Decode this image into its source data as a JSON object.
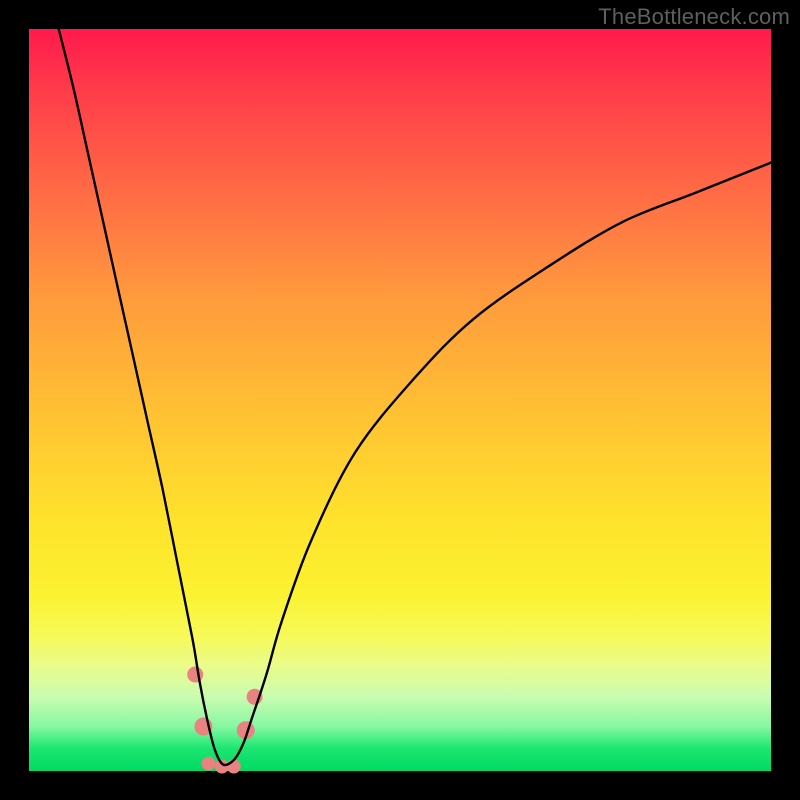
{
  "watermark": "TheBottleneck.com",
  "chart_data": {
    "type": "line",
    "title": "",
    "xlabel": "",
    "ylabel": "",
    "xlim": [
      0,
      100
    ],
    "ylim": [
      0,
      100
    ],
    "background_gradient": {
      "top_color": "#ff1a4d",
      "bottom_color": "#00d964",
      "meaning": "bottleneck severity (red=high, green=low)"
    },
    "series": [
      {
        "name": "bottleneck-curve",
        "color": "#000000",
        "x": [
          4,
          6,
          8,
          10,
          12,
          14,
          16,
          18,
          20,
          22,
          23,
          24,
          25,
          26,
          27,
          28,
          29,
          30,
          32,
          34,
          38,
          44,
          52,
          60,
          70,
          80,
          90,
          100
        ],
        "y": [
          100,
          92,
          83,
          74,
          65,
          56,
          47,
          38,
          28,
          18,
          12,
          7,
          3,
          1,
          1,
          2,
          4,
          7,
          13,
          20,
          31,
          43,
          53,
          61,
          68,
          74,
          78,
          82
        ]
      }
    ],
    "markers": [
      {
        "name": "marker-left-upper",
        "x": 22.4,
        "y": 13.0,
        "color": "#e98382",
        "r": 8
      },
      {
        "name": "marker-left-lower",
        "x": 23.5,
        "y": 6.0,
        "color": "#e98382",
        "r": 9
      },
      {
        "name": "marker-bottom-1",
        "x": 24.2,
        "y": 1.0,
        "color": "#e98382",
        "r": 7
      },
      {
        "name": "marker-bottom-2",
        "x": 26.0,
        "y": 0.6,
        "color": "#e98382",
        "r": 7
      },
      {
        "name": "marker-bottom-3",
        "x": 27.6,
        "y": 0.6,
        "color": "#e98382",
        "r": 7
      },
      {
        "name": "marker-right-lower",
        "x": 29.2,
        "y": 5.5,
        "color": "#e98382",
        "r": 9
      },
      {
        "name": "marker-right-upper",
        "x": 30.4,
        "y": 10.0,
        "color": "#e98382",
        "r": 8
      }
    ]
  }
}
